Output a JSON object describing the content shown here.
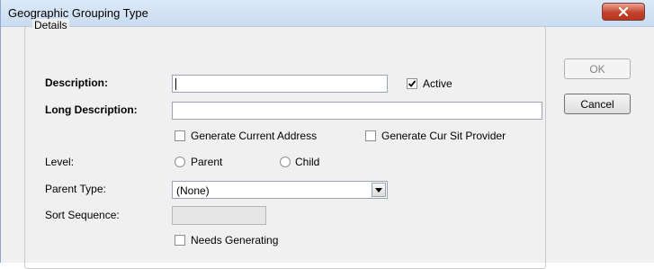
{
  "window": {
    "title": "Geographic Grouping Type",
    "close_icon": "close-x-icon"
  },
  "details": {
    "group_label": "Details",
    "description": {
      "label": "Description:",
      "value": ""
    },
    "active": {
      "label": "Active",
      "checked": true
    },
    "long_description": {
      "label": "Long Description:",
      "value": ""
    },
    "generate_current_address": {
      "label": "Generate Current Address",
      "checked": false
    },
    "generate_cur_sit_provider": {
      "label": "Generate Cur Sit Provider",
      "checked": false
    },
    "level": {
      "label": "Level:",
      "options": [
        {
          "label": "Parent",
          "selected": false
        },
        {
          "label": "Child",
          "selected": false
        }
      ]
    },
    "parent_type": {
      "label": "Parent Type:",
      "selected": "(None)"
    },
    "sort_sequence": {
      "label": "Sort Sequence:",
      "value": ""
    },
    "needs_generating": {
      "label": "Needs Generating",
      "checked": false
    }
  },
  "buttons": {
    "ok": "OK",
    "cancel": "Cancel"
  }
}
